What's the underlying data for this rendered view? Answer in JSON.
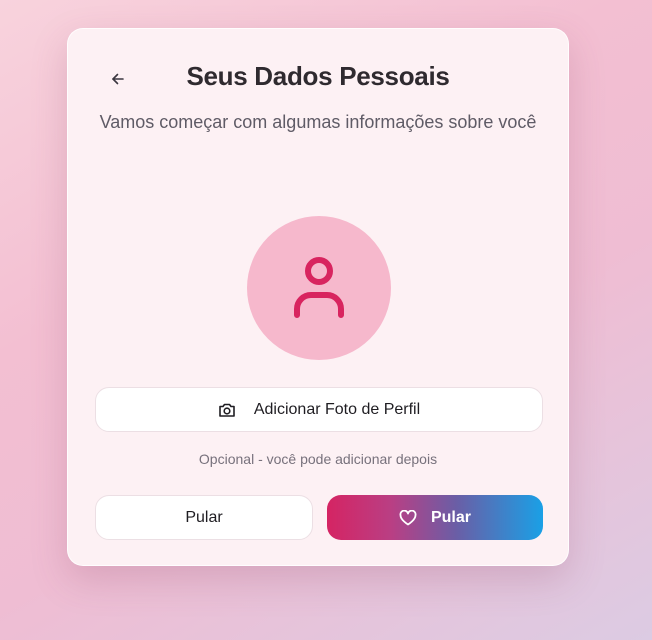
{
  "header": {
    "back_icon": "arrow-left-icon",
    "title": "Seus Dados Pessoais",
    "subtitle": "Vamos começar com algumas informações sobre você"
  },
  "avatar": {
    "icon": "user-icon",
    "background_color": "#f6b8cc",
    "icon_color": "#d8245f"
  },
  "add_photo": {
    "icon": "camera-icon",
    "label": "Adicionar Foto de Perfil"
  },
  "optional_note": "Opcional - você pode adicionar depois",
  "actions": {
    "skip_label": "Pular",
    "primary_label": "Pular",
    "primary_icon": "heart-icon",
    "gradient_colors": [
      "#d52463",
      "#1aa0e6"
    ]
  }
}
